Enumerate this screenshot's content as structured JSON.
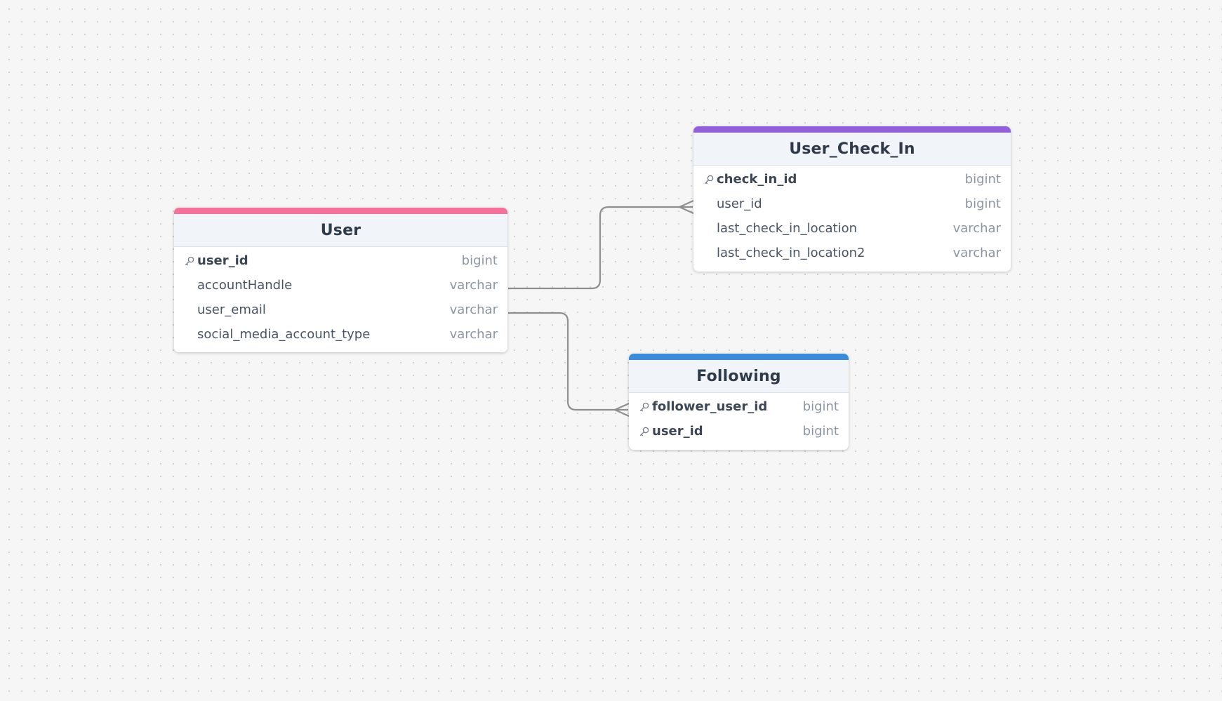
{
  "colors": {
    "user_accent": "#f4729a",
    "user_check_in_accent": "#9260db",
    "following_accent": "#3a8cdb",
    "connector": "#8f8f8f"
  },
  "tables": {
    "user": {
      "name": "User",
      "fields": [
        {
          "name": "user_id",
          "type": "bigint",
          "pk": true,
          "icon": "key-icon"
        },
        {
          "name": "accountHandle",
          "type": "varchar",
          "pk": false
        },
        {
          "name": "user_email",
          "type": "varchar",
          "pk": false
        },
        {
          "name": "social_media_account_type",
          "type": "varchar",
          "pk": false
        }
      ]
    },
    "user_check_in": {
      "name": "User_Check_In",
      "fields": [
        {
          "name": "check_in_id",
          "type": "bigint",
          "pk": true,
          "icon": "key-icon"
        },
        {
          "name": "user_id",
          "type": "bigint",
          "pk": false
        },
        {
          "name": "last_check_in_location",
          "type": "varchar",
          "pk": false
        },
        {
          "name": "last_check_in_location2",
          "type": "varchar",
          "pk": false
        }
      ]
    },
    "following": {
      "name": "Following",
      "fields": [
        {
          "name": "follower_user_id",
          "type": "bigint",
          "pk": true,
          "icon": "key-icon"
        },
        {
          "name": "user_id",
          "type": "bigint",
          "pk": true,
          "icon": "key-icon"
        }
      ]
    }
  },
  "relationships": [
    {
      "from": "User.accountHandle",
      "to": "User_Check_In.user_id",
      "end_marker": "crow-foot-many"
    },
    {
      "from": "User.user_email",
      "to": "Following.follower_user_id",
      "end_marker": "crow-foot-many"
    }
  ]
}
